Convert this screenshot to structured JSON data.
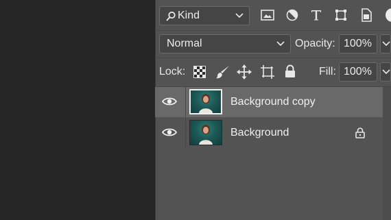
{
  "filter": {
    "kind_label": "Kind"
  },
  "blend": {
    "mode_label": "Normal",
    "opacity_label": "Opacity:",
    "opacity_value": "100%"
  },
  "lock": {
    "lock_label": "Lock:",
    "fill_label": "Fill:",
    "fill_value": "100%"
  },
  "layers": [
    {
      "name": "Background copy",
      "selected": true,
      "visible": true,
      "locked": false
    },
    {
      "name": "Background",
      "selected": false,
      "visible": true,
      "locked": true
    }
  ],
  "icons": {
    "filter": [
      "pixel-layer-filter-icon",
      "adjustment-layer-filter-icon",
      "type-layer-filter-icon",
      "shape-layer-filter-icon",
      "smart-object-filter-icon",
      "filter-toggle-icon"
    ],
    "lock": [
      "lock-transparent-pixels-icon",
      "lock-image-pixels-icon",
      "lock-position-icon",
      "lock-artboard-icon",
      "lock-all-icon"
    ]
  },
  "colors": {
    "panel": "#535353",
    "selected_row": "#696969",
    "canvas": "#262626"
  }
}
